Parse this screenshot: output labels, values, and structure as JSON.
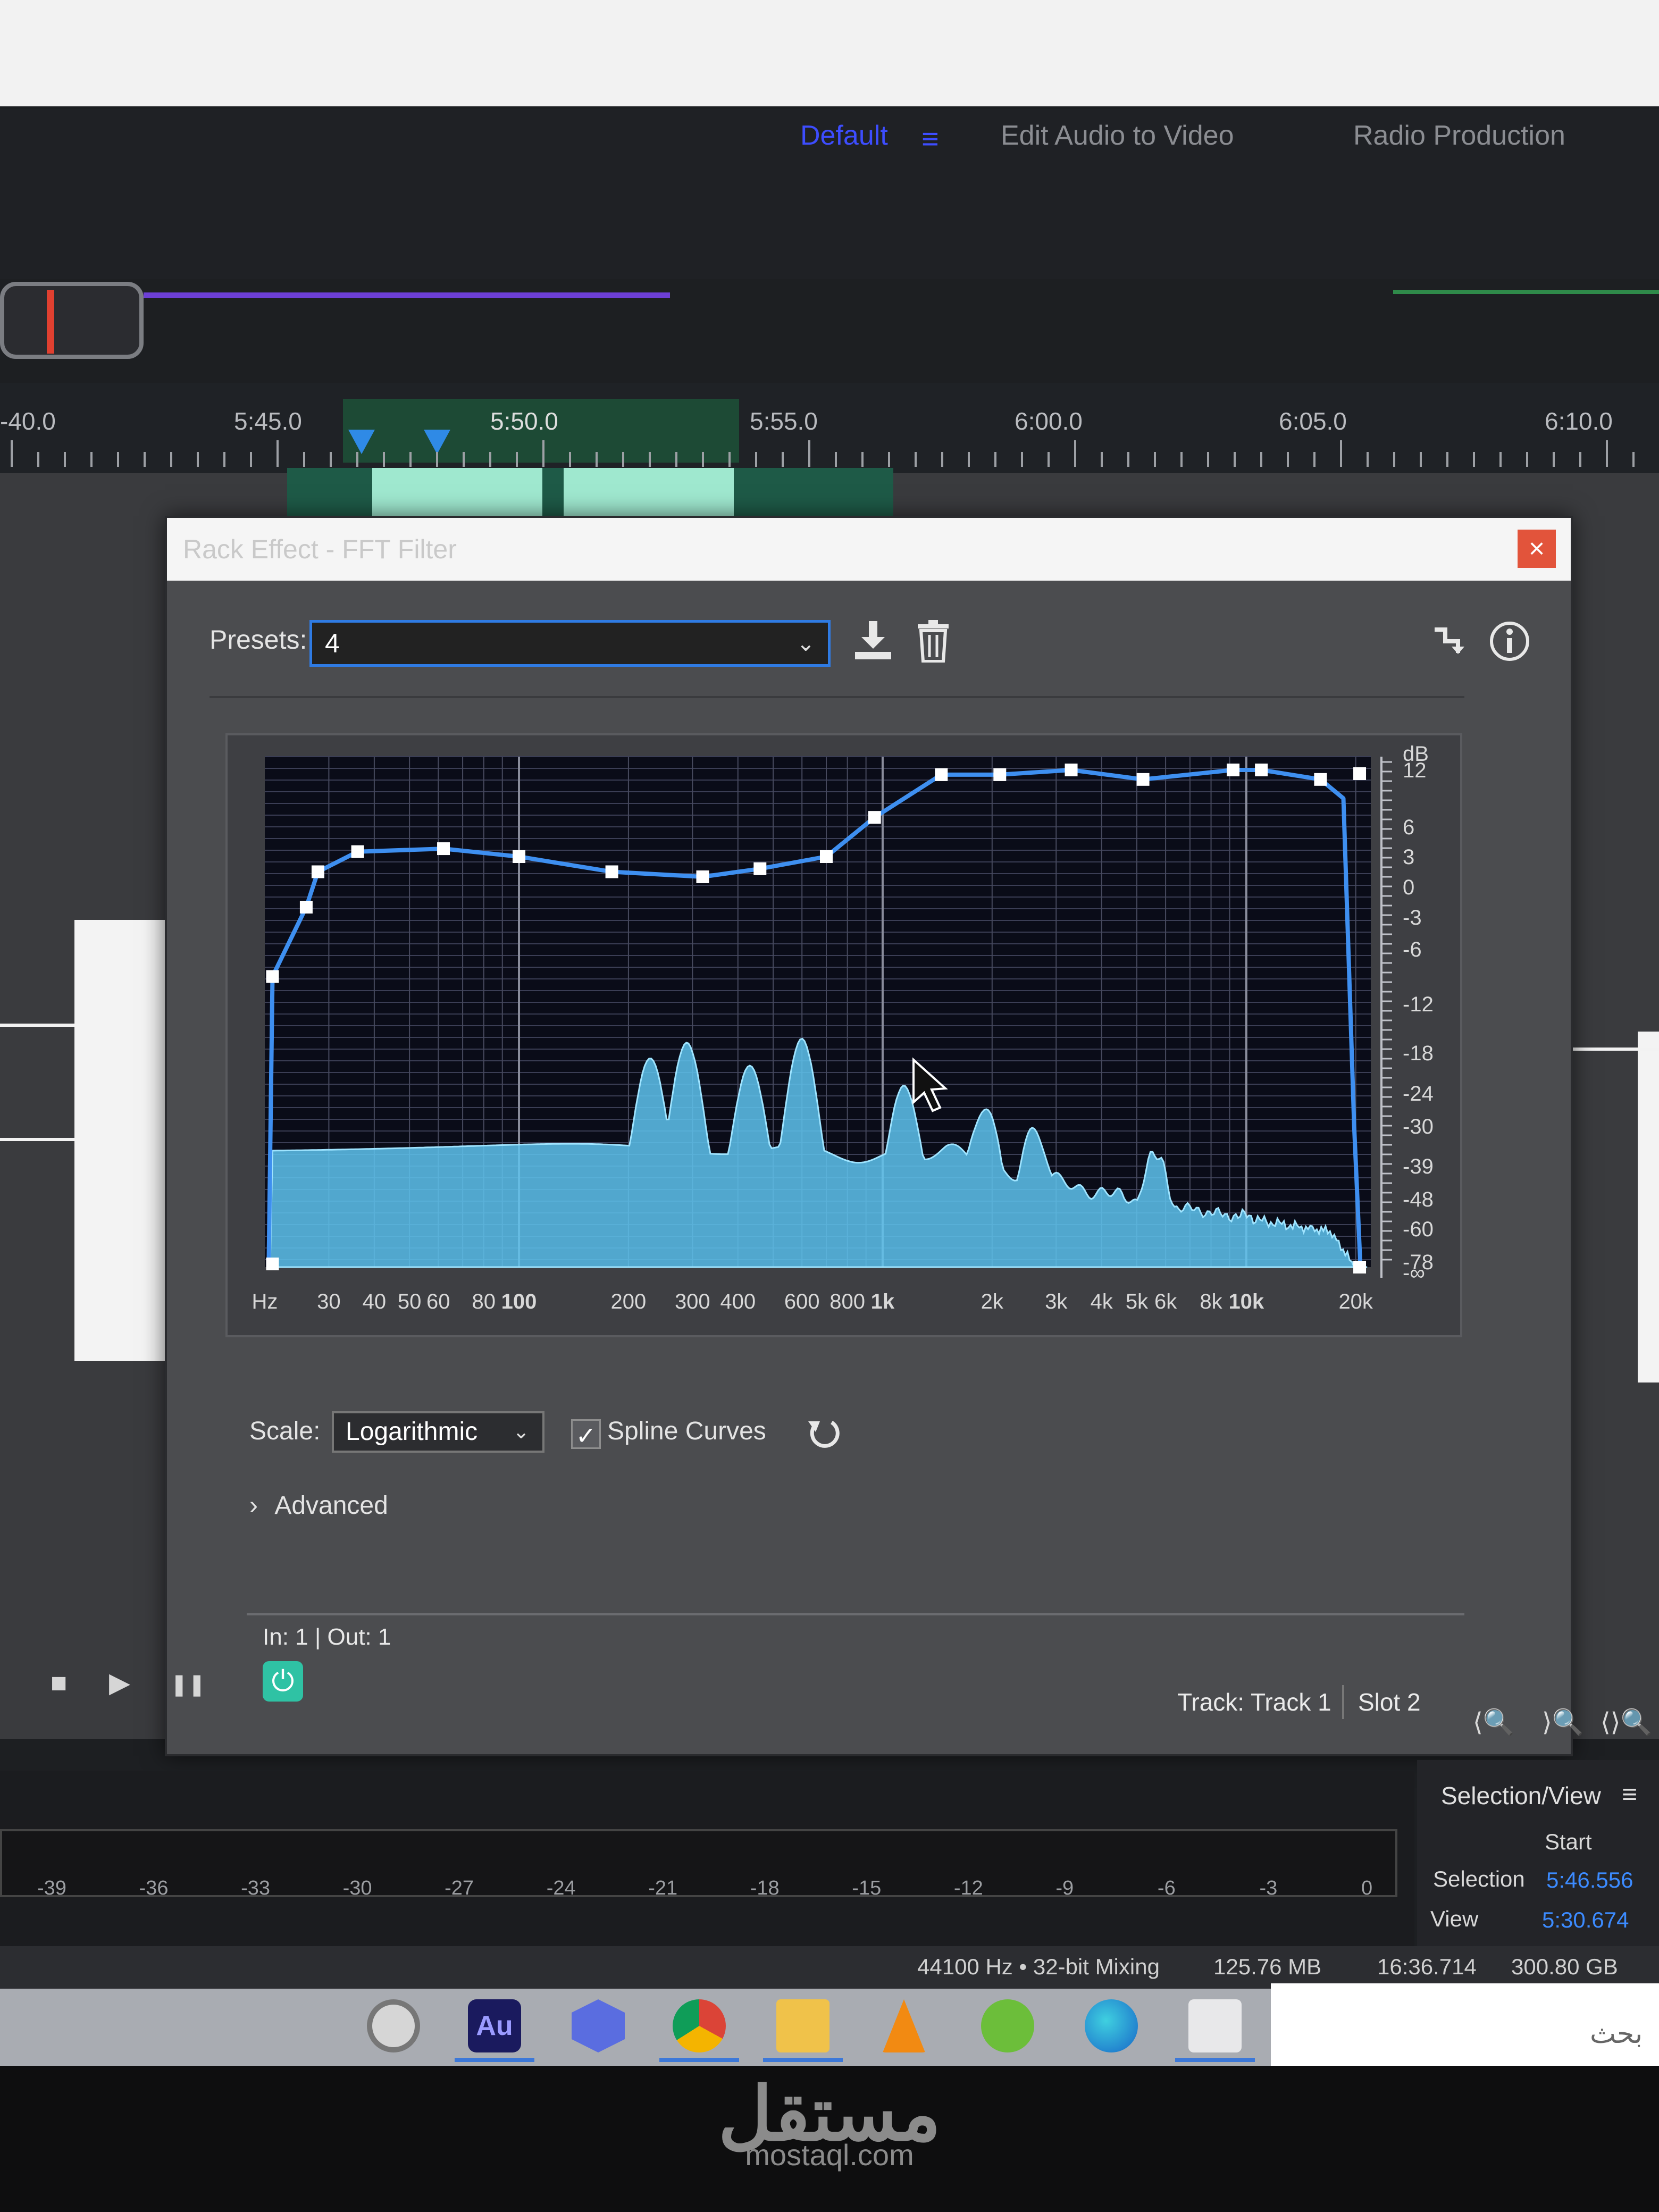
{
  "workspace": {
    "tabs": [
      {
        "label": "Default"
      },
      {
        "label": "Edit Audio to Video"
      },
      {
        "label": "Radio Production"
      }
    ],
    "menu_glyph": "≡"
  },
  "timeline": {
    "labels": [
      "-40.0",
      "5:45.0",
      "5:50.0",
      "5:55.0",
      "6:00.0",
      "6:05.0",
      "6:10.0"
    ]
  },
  "dialog": {
    "title": "Rack Effect - FFT Filter",
    "close": "×",
    "presets_label": "Presets:",
    "preset_value": "4",
    "chevron": "⌄",
    "scale_label": "Scale:",
    "scale_value": "Logarithmic",
    "spline_label": "Spline Curves",
    "spline_checked": "✓",
    "advanced_label": "Advanced",
    "advanced_arrow": "›",
    "in_out": "In: 1 | Out: 1",
    "power_glyph": "⏻",
    "track_label": "Track: Track 1",
    "slot_label": "Slot 2",
    "freq_labels": [
      "Hz",
      "30",
      "40",
      "50",
      "60",
      "80",
      "100",
      "200",
      "300",
      "400",
      "600",
      "800",
      "1k",
      "2k",
      "3k",
      "4k",
      "5k",
      "6k",
      "8k",
      "10k",
      "20k"
    ],
    "db_labels": [
      "dB",
      "12",
      "6",
      "3",
      "0",
      "-3",
      "-6",
      "-12",
      "-18",
      "-24",
      "-30",
      "-39",
      "-48",
      "-60",
      "-78",
      "-∞"
    ]
  },
  "eq_graph": {
    "curve_color": "#3e8ff0",
    "spectrum_color": "#5ec3ef",
    "control_points_db": [
      {
        "hz": 21,
        "db": -9
      },
      {
        "hz": 26,
        "db": -2
      },
      {
        "hz": 28,
        "db": 1.5
      },
      {
        "hz": 36,
        "db": 3.5
      },
      {
        "hz": 62,
        "db": 3.8
      },
      {
        "hz": 100,
        "db": 3
      },
      {
        "hz": 180,
        "db": 1.5
      },
      {
        "hz": 320,
        "db": 1
      },
      {
        "hz": 460,
        "db": 1.8
      },
      {
        "hz": 700,
        "db": 3
      },
      {
        "hz": 950,
        "db": 7
      },
      {
        "hz": 1450,
        "db": 11.5
      },
      {
        "hz": 2100,
        "db": 11.5
      },
      {
        "hz": 3300,
        "db": 12
      },
      {
        "hz": 5200,
        "db": 11
      },
      {
        "hz": 9200,
        "db": 12
      },
      {
        "hz": 11000,
        "db": 12
      },
      {
        "hz": 16000,
        "db": 11
      }
    ]
  },
  "transport": {
    "stop": "■",
    "play": "▶",
    "pause": "❚❚"
  },
  "zoom": {
    "a": "⟨🔍",
    "b": "⟩🔍",
    "c": "⟨⟩🔍"
  },
  "meter": {
    "labels": [
      "-39",
      "-36",
      "-33",
      "-30",
      "-27",
      "-24",
      "-21",
      "-18",
      "-15",
      "-12",
      "-9",
      "-6",
      "-3",
      "0"
    ]
  },
  "selection_view": {
    "title": "Selection/View",
    "menu": "≡",
    "start_header": "Start",
    "selection_label": "Selection",
    "selection_start": "5:46.556",
    "view_label": "View",
    "view_start": "5:30.674"
  },
  "status": {
    "sample_rate": "44100 Hz • 32-bit Mixing",
    "size": "125.76 MB",
    "duration": "16:36.714",
    "free": "300.80 GB free"
  },
  "taskbar": {
    "au_label": "Au",
    "search_placeholder": "بحث"
  },
  "watermark": {
    "logo": "مستقل",
    "url": "mostaql.com"
  }
}
